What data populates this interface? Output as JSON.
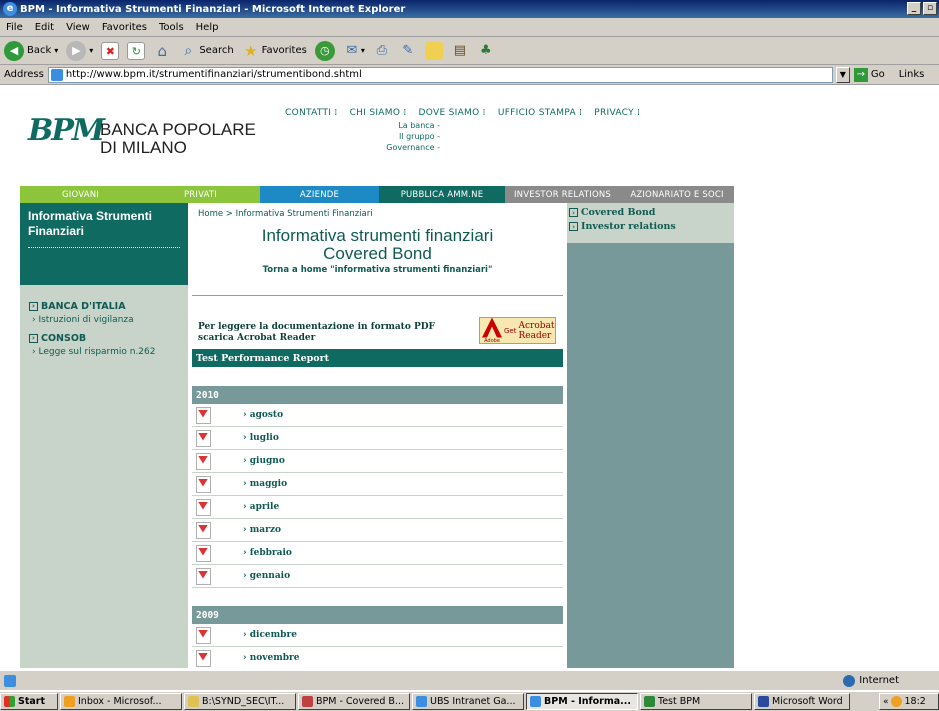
{
  "window": {
    "title": "BPM - Informativa Strumenti Finanziari - Microsoft Internet Explorer"
  },
  "menu": [
    "File",
    "Edit",
    "View",
    "Favorites",
    "Tools",
    "Help"
  ],
  "toolbar": {
    "back": "Back",
    "search": "Search",
    "favorites": "Favorites"
  },
  "address": {
    "label": "Address",
    "url": "http://www.bpm.it/strumentifinanziari/strumentibond.shtml",
    "go": "Go",
    "links": "Links"
  },
  "site": {
    "logo": "BPM",
    "bank_name_1": "BANCA POPOLARE",
    "bank_name_2": "DI MILANO",
    "top_links": [
      "CONTATTI",
      "CHI SIAMO",
      "DOVE SIAMO",
      "UFFICIO STAMPA",
      "PRIVACY"
    ],
    "chi_siamo_sub": [
      "La banca -",
      "Il gruppo -",
      "Governance -"
    ],
    "nav_tabs": [
      {
        "label": "GIOVANI",
        "color": "#8cc43c"
      },
      {
        "label": "PRIVATI",
        "color": "#8cc43c"
      },
      {
        "label": "AZIENDE",
        "color": "#1d8ac6"
      },
      {
        "label": "PUBBLICA AMM.NE",
        "color": "#0f6b62"
      },
      {
        "label": "INVESTOR RELATIONS",
        "color": "#8a8a8a"
      },
      {
        "label": "AZIONARIATO E SOCI",
        "color": "#8a8a8a"
      }
    ]
  },
  "left": {
    "heading_1": "Informativa Strumenti",
    "heading_2": "Finanziari",
    "sections": [
      {
        "title": "BANCA D'ITALIA",
        "sub": "Istruzioni di vigilanza"
      },
      {
        "title": "CONSOB",
        "sub": "Legge sul risparmio n.262"
      }
    ]
  },
  "main": {
    "breadcrumb": "Home > Informativa Strumenti Finanziari",
    "title_1": "Informativa strumenti finanziari",
    "title_2": "Covered Bond",
    "back_link": "Torna a home \"informativa strumenti finanziari\"",
    "pdf_note_1": "Per leggere la documentazione in formato PDF",
    "pdf_note_2": "scarica Acrobat Reader",
    "acrobat_get": "Get",
    "acrobat_1": "Acrobat",
    "acrobat_2": "Reader",
    "acrobat_adobe": "Adobe",
    "report_title": "Test Performance Report",
    "years": [
      {
        "year": "2010",
        "months": [
          "agosto",
          "luglio",
          "giugno",
          "maggio",
          "aprile",
          "marzo",
          "febbraio",
          "gennaio"
        ]
      },
      {
        "year": "2009",
        "months": [
          "dicembre",
          "novembre"
        ]
      }
    ]
  },
  "right": {
    "links": [
      "Covered Bond",
      "Investor relations"
    ]
  },
  "status": {
    "zone": "Internet"
  },
  "taskbar": {
    "start": "Start",
    "tasks": [
      {
        "label": "Inbox - Microsof...",
        "color": "#f0a020"
      },
      {
        "label": "B:\\SYND_SEC\\IT...",
        "color": "#e0c050"
      },
      {
        "label": "BPM - Covered B...",
        "color": "#c04040"
      },
      {
        "label": "UBS Intranet Ga...",
        "color": "#3b8ee0"
      },
      {
        "label": "BPM - Informa...",
        "color": "#3b8ee0"
      },
      {
        "label": "Test BPM",
        "color": "#2a8a3a"
      },
      {
        "label": "Microsoft Word",
        "color": "#2a4aa0"
      }
    ],
    "clock": "18:2"
  }
}
